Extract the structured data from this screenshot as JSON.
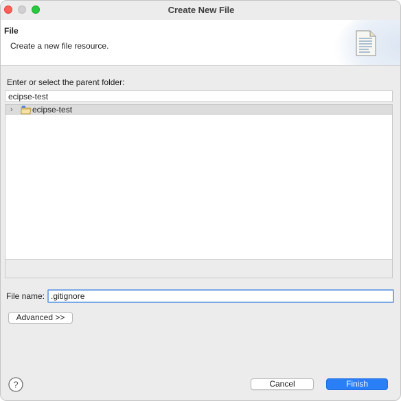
{
  "window": {
    "title": "Create New File"
  },
  "banner": {
    "title": "File",
    "description": "Create a new file resource.",
    "icon": "file-document-icon"
  },
  "parent_folder": {
    "label": "Enter or select the parent folder:",
    "value": "ecipse-test"
  },
  "tree": {
    "items": [
      {
        "label": "ecipse-test",
        "icon": "project-folder-icon",
        "expanded": false,
        "selected": true
      }
    ]
  },
  "file_name": {
    "label": "File name:",
    "value": ".gitignore"
  },
  "buttons": {
    "advanced": "Advanced >>",
    "cancel": "Cancel",
    "finish": "Finish"
  },
  "colors": {
    "accent": "#2a7ff7",
    "focus_ring": "#7aa7e6",
    "close": "#ff5f57",
    "maximize": "#28c840"
  }
}
